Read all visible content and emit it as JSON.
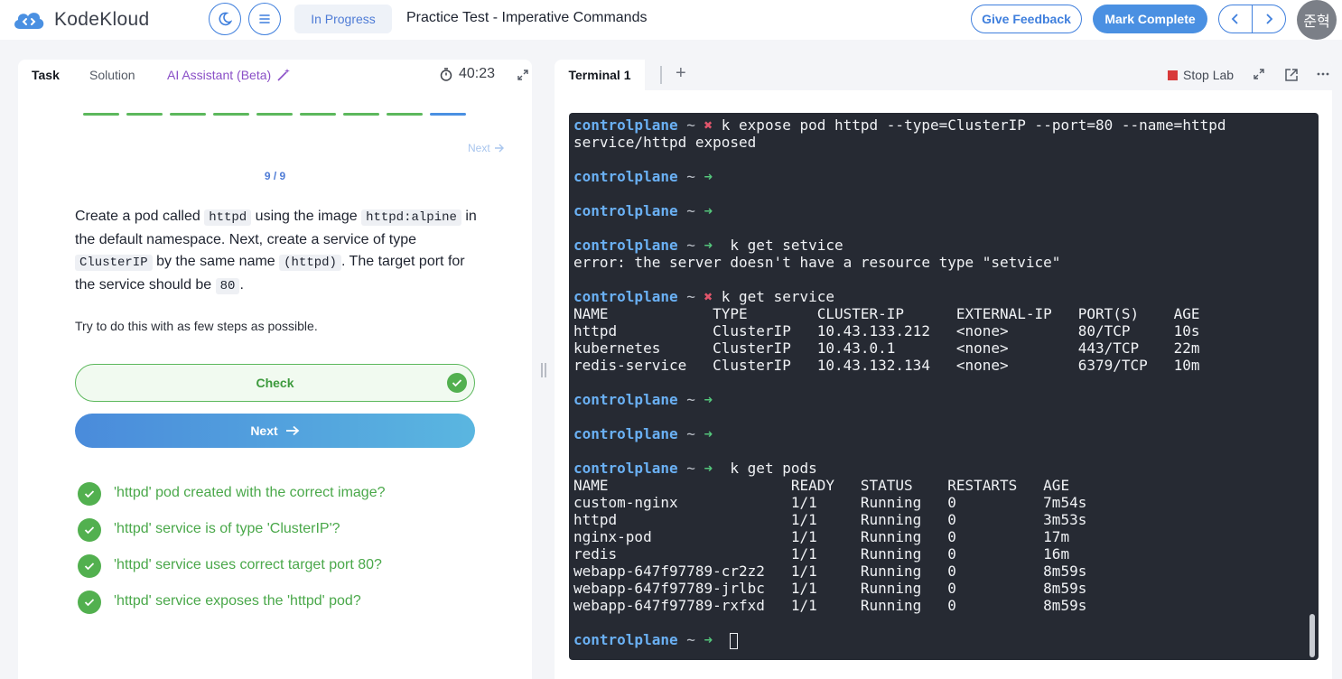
{
  "header": {
    "brand": "KodeKloud",
    "status": "In Progress",
    "title": "Practice Test - Imperative Commands",
    "feedback_label": "Give Feedback",
    "complete_label": "Mark Complete",
    "avatar_text": "준혁"
  },
  "task_panel": {
    "tabs": [
      "Task",
      "Solution",
      "AI Assistant (Beta)"
    ],
    "timer": "40:23",
    "next_link": "Next",
    "counter": "9 / 9",
    "progress": {
      "completed": 8,
      "total": 9
    },
    "question": {
      "t1": "Create a pod called ",
      "c1": "httpd",
      "t2": " using the image ",
      "c2": "httpd:alpine",
      "t3": " in the default namespace. Next, create a service of type ",
      "c3": "ClusterIP",
      "t4": " by the same name ",
      "c4": "(httpd)",
      "t5": ". The target port for the service should be ",
      "c5": "80",
      "t6": "."
    },
    "hint": "Try to do this with as few steps as possible.",
    "check_label": "Check",
    "next_label": "Next",
    "results": [
      "'httpd' pod created with the correct image?",
      "'httpd' service is of type 'ClusterIP'?",
      "'httpd' service uses correct target port 80?",
      "'httpd' service exposes the 'httpd' pod?"
    ]
  },
  "terminal_panel": {
    "tab": "Terminal 1",
    "stop_label": "Stop Lab",
    "prompt_host": "controlplane",
    "lines": [
      {
        "kind": "prompt",
        "status": "fail",
        "cmd": " k expose pod httpd --type=ClusterIP --port=80 --name=httpd"
      },
      {
        "kind": "out",
        "text": "service/httpd exposed"
      },
      {
        "kind": "out",
        "text": ""
      },
      {
        "kind": "prompt",
        "status": "ok",
        "cmd": ""
      },
      {
        "kind": "out",
        "text": ""
      },
      {
        "kind": "prompt",
        "status": "ok",
        "cmd": ""
      },
      {
        "kind": "out",
        "text": ""
      },
      {
        "kind": "prompt",
        "status": "ok",
        "cmd": "  k get setvice"
      },
      {
        "kind": "out",
        "text": "error: the server doesn't have a resource type \"setvice\""
      },
      {
        "kind": "out",
        "text": ""
      },
      {
        "kind": "prompt",
        "status": "fail",
        "cmd": " k get service"
      },
      {
        "kind": "out",
        "text": "NAME            TYPE        CLUSTER-IP      EXTERNAL-IP   PORT(S)    AGE"
      },
      {
        "kind": "out",
        "text": "httpd           ClusterIP   10.43.133.212   <none>        80/TCP     10s"
      },
      {
        "kind": "out",
        "text": "kubernetes      ClusterIP   10.43.0.1       <none>        443/TCP    22m"
      },
      {
        "kind": "out",
        "text": "redis-service   ClusterIP   10.43.132.134   <none>        6379/TCP   10m"
      },
      {
        "kind": "out",
        "text": ""
      },
      {
        "kind": "prompt",
        "status": "ok",
        "cmd": ""
      },
      {
        "kind": "out",
        "text": ""
      },
      {
        "kind": "prompt",
        "status": "ok",
        "cmd": ""
      },
      {
        "kind": "out",
        "text": ""
      },
      {
        "kind": "prompt",
        "status": "ok",
        "cmd": "  k get pods"
      },
      {
        "kind": "out",
        "text": "NAME                     READY   STATUS    RESTARTS   AGE"
      },
      {
        "kind": "out",
        "text": "custom-nginx             1/1     Running   0          7m54s"
      },
      {
        "kind": "out",
        "text": "httpd                    1/1     Running   0          3m53s"
      },
      {
        "kind": "out",
        "text": "nginx-pod                1/1     Running   0          17m"
      },
      {
        "kind": "out",
        "text": "redis                    1/1     Running   0          16m"
      },
      {
        "kind": "out",
        "text": "webapp-647f97789-cr2z2   1/1     Running   0          8m59s"
      },
      {
        "kind": "out",
        "text": "webapp-647f97789-jrlbc   1/1     Running   0          8m59s"
      },
      {
        "kind": "out",
        "text": "webapp-647f97789-rxfxd   1/1     Running   0          8m59s"
      },
      {
        "kind": "out",
        "text": ""
      },
      {
        "kind": "prompt",
        "status": "ok",
        "cmd": "  ",
        "cursor": true
      }
    ]
  },
  "colors": {
    "accent": "#4a90e2",
    "success": "#52b04f",
    "terminal_bg": "#262a33",
    "prompt": "#6ab0f3"
  }
}
